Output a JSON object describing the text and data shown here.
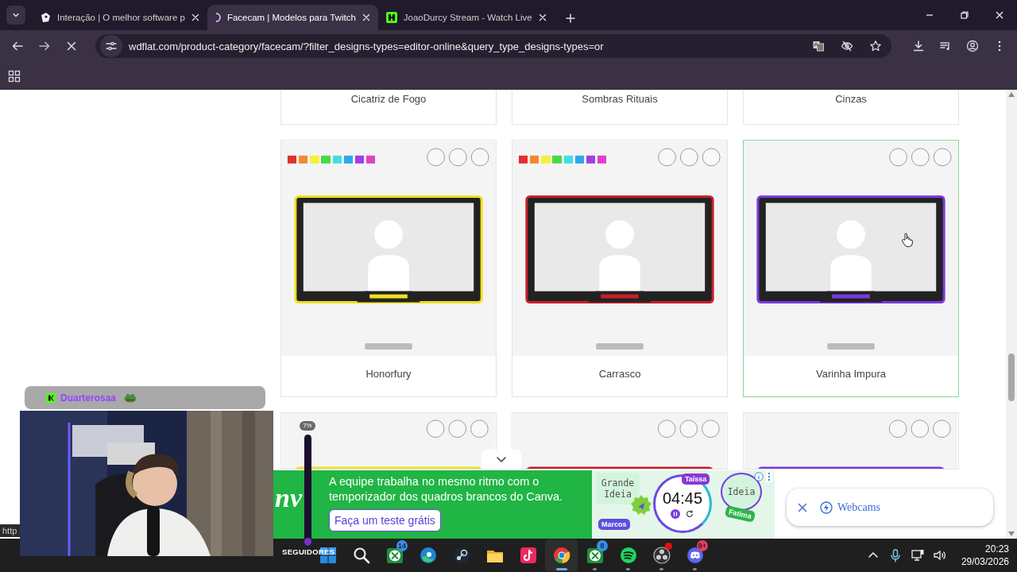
{
  "browser": {
    "tabs": [
      {
        "title": "Interação | O melhor software p",
        "kind": "site",
        "selected": false
      },
      {
        "title": "Facecam | Modelos para Twitch",
        "kind": "loading",
        "selected": true
      },
      {
        "title": "JoaoDurcy Stream - Watch Live",
        "kind": "stream",
        "selected": false
      }
    ],
    "address": "wdflat.com/product-category/facecam/?filter_designs-types=editor-online&query_type_designs-types=or",
    "loading": true
  },
  "page": {
    "products": [
      {
        "name": "Cicatriz de Fogo",
        "kind": "cut",
        "highlighted": false
      },
      {
        "name": "Sombras Rituais",
        "kind": "cut",
        "highlighted": false
      },
      {
        "name": "Cinzas",
        "kind": "cut",
        "highlighted": false
      },
      {
        "name": "Honorfury",
        "kind": "full",
        "highlighted": false
      },
      {
        "name": "Carrasco",
        "kind": "full",
        "highlighted": false
      },
      {
        "name": "Varinha Impura",
        "kind": "full",
        "highlighted": true
      },
      {
        "kind": "partial",
        "highlighted": false
      },
      {
        "kind": "partial",
        "highlighted": false
      },
      {
        "kind": "partial",
        "highlighted": false
      }
    ]
  },
  "status_url": "http",
  "stream_overlay": {
    "chat_user": "Duarterosaa",
    "goal": {
      "percent": "7%",
      "level": 0.07,
      "label": "SEGUIDORES"
    }
  },
  "ad": {
    "logo": "nv",
    "text": "A equipe trabalha no mesmo ritmo com o temporizador dos quadros brancos do Canva.",
    "button": "Faça um teste grátis",
    "illustration": {
      "notes": [
        "Grande Ideia",
        "Ideia"
      ],
      "timer": "04:45",
      "people": [
        {
          "name": "Taíssa",
          "color": "#8a37d8"
        },
        {
          "name": "Marcos",
          "color": "#5a4fe0"
        },
        {
          "name": "Fatima",
          "color": "#2db34a"
        }
      ]
    }
  },
  "notification": {
    "label": "Webcams"
  },
  "taskbar": {
    "apps": [
      {
        "kind": "windows",
        "running": false,
        "selected": false,
        "alert": false
      },
      {
        "kind": "search",
        "running": false,
        "selected": false,
        "alert": false
      },
      {
        "kind": "xbox",
        "badge": "14",
        "running": false,
        "selected": false,
        "alert": false
      },
      {
        "kind": "edge",
        "running": false,
        "selected": false,
        "alert": false
      },
      {
        "kind": "steam",
        "running": false,
        "selected": false,
        "alert": false
      },
      {
        "kind": "files",
        "running": false,
        "selected": false,
        "alert": false
      },
      {
        "kind": "tiktok",
        "running": false,
        "selected": false,
        "alert": false
      },
      {
        "kind": "chrome",
        "running": true,
        "selected": true,
        "alert": false
      },
      {
        "kind": "xbox",
        "badge": "8",
        "running": true,
        "selected": false,
        "alert": false
      },
      {
        "kind": "spotify",
        "running": true,
        "selected": false,
        "alert": false
      },
      {
        "kind": "obs",
        "running": true,
        "selected": false,
        "alert": true
      },
      {
        "kind": "discord",
        "badge": "9+",
        "running": true,
        "selected": false,
        "alert": false
      }
    ],
    "time": "20:23",
    "date": "29/03/2026"
  }
}
